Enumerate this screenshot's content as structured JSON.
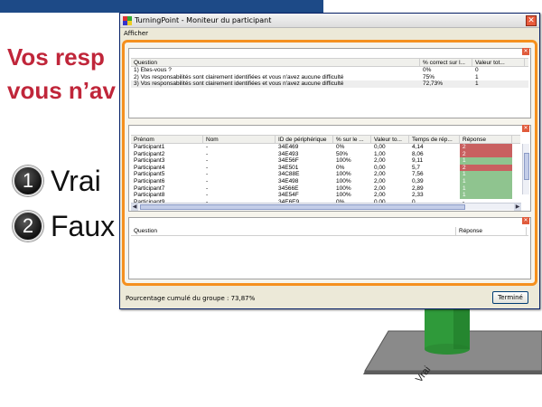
{
  "slide": {
    "heading_line1": "Vos resp",
    "heading_line2": "vous n’av",
    "options": [
      {
        "num": "1",
        "label": "Vrai"
      },
      {
        "num": "2",
        "label": "Faux"
      }
    ],
    "chart_axis_label": "Vrai",
    "colors": {
      "topbar": "#1d4a87",
      "heading": "#c0263a",
      "bar": "#2f9a3a",
      "accent_orange": "#f5901e"
    }
  },
  "window": {
    "title": "TurningPoint - Moniteur du participant",
    "close_label": "✕",
    "menu": [
      "Afficher"
    ]
  },
  "questions_panel": {
    "columns": [
      "Question",
      "% correct sur l...",
      "Valeur tot..."
    ],
    "rows": [
      [
        "1) Etes-vous ?",
        "0%",
        "0"
      ],
      [
        "2) Vos responsabilités sont clairement identifiées et vous n'avez aucune difficulté",
        "75%",
        "1"
      ],
      [
        "3) Vos responsabilités sont clairement identifiées et vous n'avez aucune difficulté",
        "72,73%",
        "1"
      ]
    ]
  },
  "participants_panel": {
    "columns": [
      "Prénom",
      "Nom",
      "ID de périphérique",
      "% sur le ...",
      "Valeur to...",
      "Temps de rép...",
      "Réponse"
    ],
    "rows": [
      [
        "Participant1",
        "-",
        "34E469",
        "0%",
        "0,00",
        "4,14",
        "2"
      ],
      [
        "Participant2",
        "-",
        "34E493",
        "50%",
        "1,00",
        "8,06",
        "2"
      ],
      [
        "Participant3",
        "-",
        "34E56F",
        "100%",
        "2,00",
        "9,11",
        "1"
      ],
      [
        "Participant4",
        "-",
        "34E501",
        "0%",
        "0,00",
        "5,7",
        "2"
      ],
      [
        "Participant5",
        "-",
        "34C88E",
        "100%",
        "2,00",
        "7,56",
        "1"
      ],
      [
        "Participant6",
        "-",
        "34E498",
        "100%",
        "2,00",
        "0,39",
        "1"
      ],
      [
        "Participant7",
        "-",
        "34566E",
        "100%",
        "2,00",
        "2,89",
        "1"
      ],
      [
        "Participant8",
        "-",
        "34E54F",
        "100%",
        "2,00",
        "2,33",
        "1"
      ],
      [
        "Participant9",
        "-",
        "34E6E9",
        "0%",
        "0,00",
        "0",
        "-"
      ]
    ]
  },
  "detail_panel": {
    "columns": [
      "Question",
      "Réponse"
    ]
  },
  "footer": {
    "group_score": "Pourcentage cumulé du groupe : 73,87%",
    "done_label": "Terminé"
  }
}
